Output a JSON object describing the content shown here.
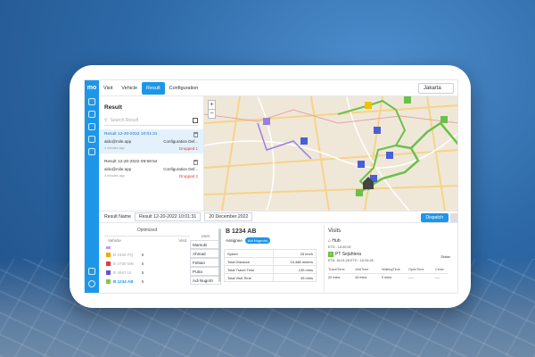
{
  "nav": {
    "tabs": [
      "Visit",
      "Vehicle",
      "Result",
      "Configuration"
    ],
    "active": 2,
    "city": "Jakarta"
  },
  "rail": {
    "logo": "mo"
  },
  "result": {
    "title": "Result",
    "search_placeholder": "Search Result",
    "items": [
      {
        "title": "Result 12-20-2022 10:01:31",
        "email": "aldo@mile.app",
        "config": "Configuration Def...",
        "meta": "4 minutes ago",
        "dropped": "Dropped 1"
      },
      {
        "title": "Result 12-20-2022 09:59:54",
        "email": "aldo@mile.app",
        "config": "Configuration Def...",
        "meta": "4 minutes ago",
        "dropped": "Dropped 2"
      }
    ]
  },
  "bar": {
    "label": "Result Name",
    "name": "Result 12-20-2022 10:01:31",
    "date": "20 December 2022",
    "dispatch": "Dispatch"
  },
  "vehicles": {
    "optimized_label": "Optimized",
    "headers": [
      "Vehicle",
      "Visit"
    ],
    "rows": [
      {
        "plate": "B 1656 PQ",
        "visits": "5",
        "color": "#f2a900"
      },
      {
        "plate": "B 2780 MN",
        "visits": "5",
        "color": "#e33b3b"
      },
      {
        "plate": "B 4567 UI",
        "visits": "5",
        "color": "#6a4fd6"
      },
      {
        "plate": "B 1234 AB",
        "visits": "5",
        "color": "#8bc34a",
        "selected": true
      }
    ]
  },
  "users": {
    "header": "User",
    "list": [
      "Marsuki",
      "Ahmad",
      "Febian",
      "Putra",
      "Adi Nugroh"
    ]
  },
  "detail": {
    "plate": "B 1234 AB",
    "assignee_label": "Assignee",
    "assignee": "Adi Nugroho",
    "stats": [
      {
        "k": "Speed",
        "v": "25 km/h"
      },
      {
        "k": "Total Distance",
        "v": "15,488 meters"
      },
      {
        "k": "Total Travel Time",
        "v": "135 mins"
      },
      {
        "k": "Total Visit Time",
        "v": "45 mins"
      }
    ]
  },
  "visits": {
    "title": "Visits",
    "hub": "Hub",
    "hub_etd": "ETD : 16:00:00",
    "stop_num": "1",
    "stop_name": "PT Sejahtera",
    "stop_eta": "ETA: 16:21:28   ETD : 16:34:28",
    "distance_label": "Distar",
    "cols": [
      {
        "k": "TravelTime",
        "v": "22 mins"
      },
      {
        "k": "VisitTime",
        "v": "15 mins"
      },
      {
        "k": "WaitingTime",
        "v": "0 mins"
      },
      {
        "k": "OpenTime",
        "v": "-----"
      },
      {
        "k": "Close",
        "v": "----"
      }
    ]
  }
}
